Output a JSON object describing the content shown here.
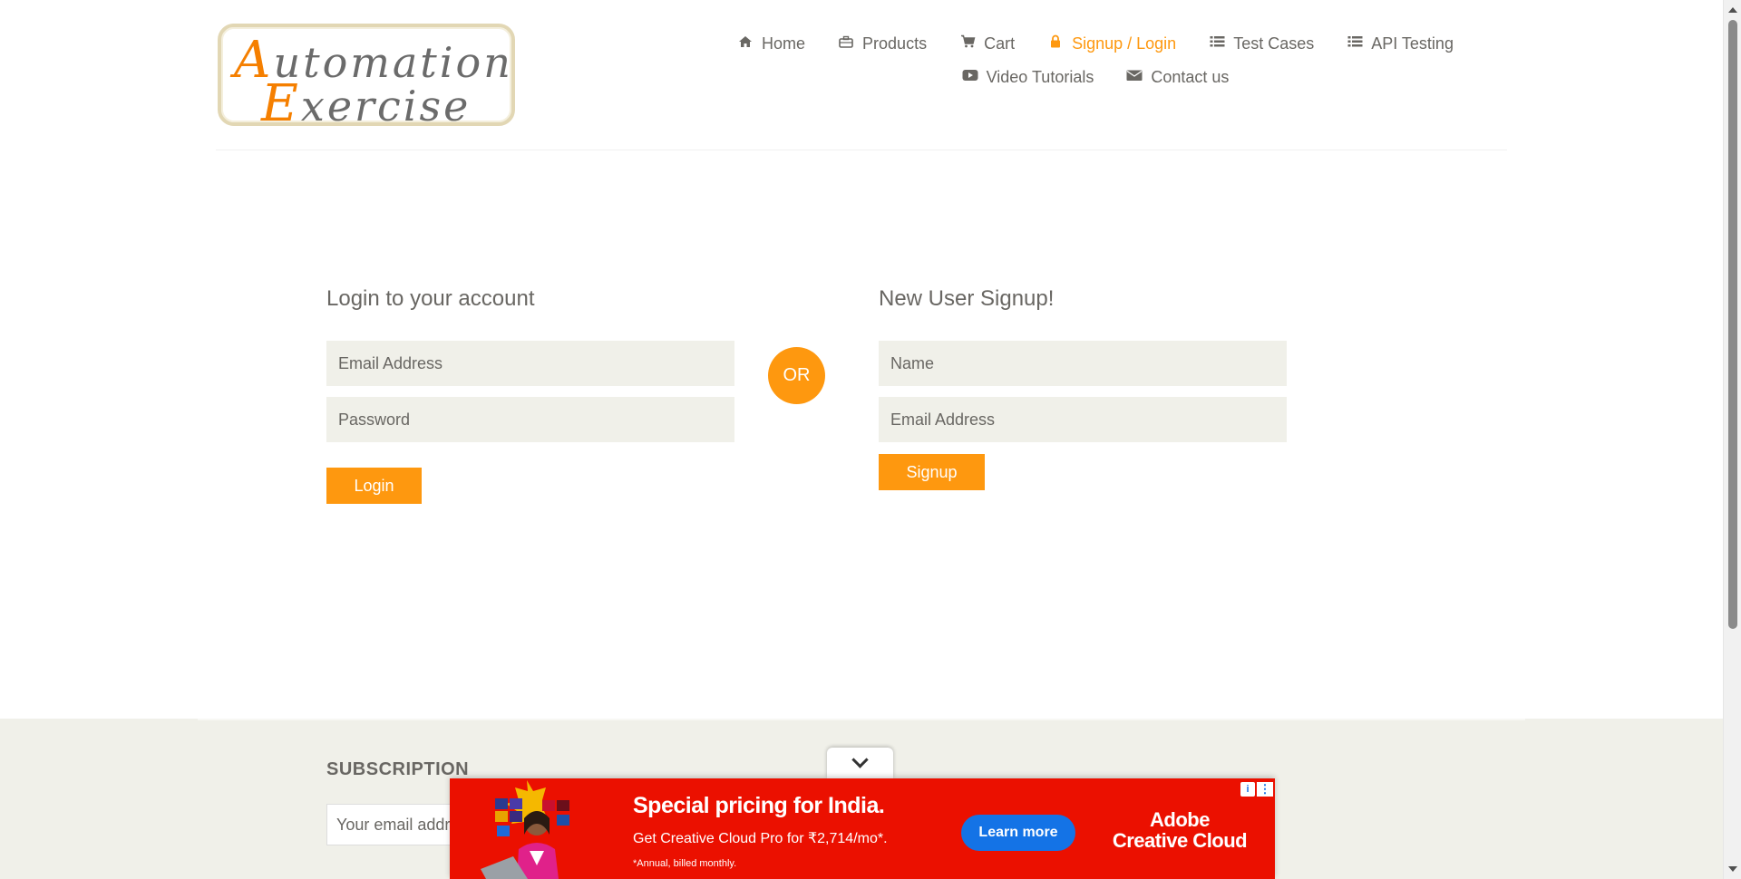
{
  "logo": {
    "line1_cap": "A",
    "line1_rest": "utomation",
    "line2_cap": "E",
    "line2_rest": "xercise"
  },
  "nav": {
    "items": [
      {
        "label": "Home",
        "icon": "home-icon"
      },
      {
        "label": "Products",
        "icon": "briefcase-icon"
      },
      {
        "label": "Cart",
        "icon": "cart-icon"
      },
      {
        "label": "Signup / Login",
        "icon": "lock-icon",
        "active": true
      },
      {
        "label": "Test Cases",
        "icon": "list-icon"
      },
      {
        "label": "API Testing",
        "icon": "list-icon"
      },
      {
        "label": "Video Tutorials",
        "icon": "youtube-play-icon"
      },
      {
        "label": "Contact us",
        "icon": "envelope-icon"
      }
    ]
  },
  "login": {
    "title": "Login to your account",
    "email_placeholder": "Email Address",
    "password_placeholder": "Password",
    "button": "Login"
  },
  "or_label": "OR",
  "signup": {
    "title": "New User Signup!",
    "name_placeholder": "Name",
    "email_placeholder": "Email Address",
    "button": "Signup"
  },
  "footer": {
    "subscription_title": "SUBSCRIPTION",
    "email_placeholder": "Your email address"
  },
  "ad": {
    "headline": "Special pricing for India.",
    "subline": "Get Creative Cloud Pro for ₹2,714/mo*.",
    "fineprint": "*Annual, billed monthly.",
    "cta": "Learn more",
    "brand_line1": "Adobe",
    "brand_line2": "Creative Cloud"
  },
  "colors": {
    "accent": "#fe980f",
    "text": "#696763",
    "input_bg": "#f0f0e9",
    "ad_bg": "#eb1000",
    "ad_cta": "#1473e6"
  }
}
